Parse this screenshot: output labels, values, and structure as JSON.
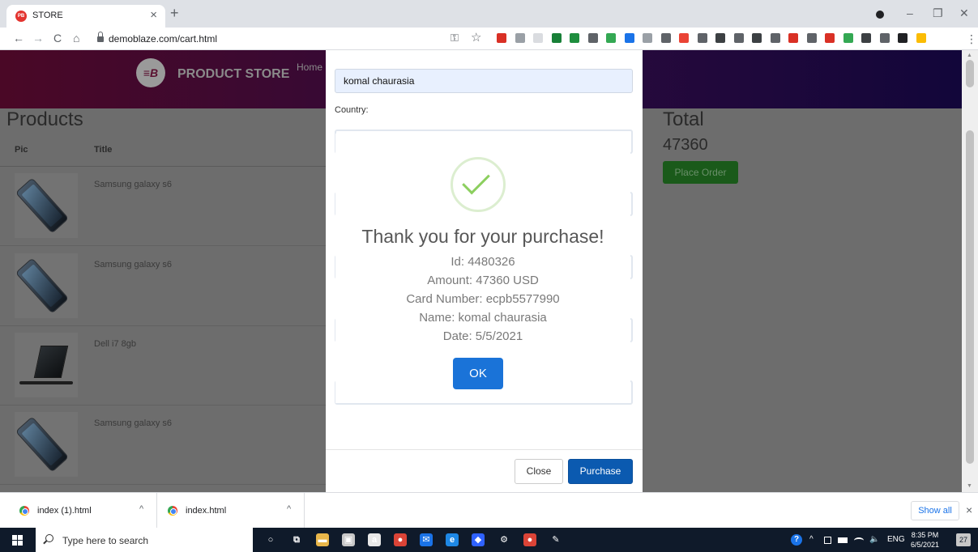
{
  "browser": {
    "tab_title": "STORE",
    "favicon_text": "PB",
    "new_tab_symbol": "+",
    "close_tab_symbol": "×",
    "url": "demoblaze.com/cart.html",
    "window_controls": [
      "–",
      "❐",
      "✕"
    ],
    "nav": {
      "back": "←",
      "forward": "→",
      "reload": "C",
      "home": "⌂"
    },
    "omnibox_icons": {
      "key": "⚿",
      "star": "☆"
    },
    "extension_colors": [
      "#d93025",
      "#9aa0a6",
      "#dadce0",
      "#188038",
      "#1e8e3e",
      "#5f6368",
      "#34a853",
      "#1a73e8",
      "#9aa0a6",
      "#5f6368",
      "#ea4335",
      "#5f6368",
      "#3c4043",
      "#5f6368",
      "#3c4043",
      "#5f6368",
      "#d93025",
      "#5f6368",
      "#d93025",
      "#34a853",
      "#3c4043",
      "#5f6368",
      "#202124",
      "#fbbc04"
    ]
  },
  "store": {
    "brand_letter": "≡B",
    "brand_name": "PRODUCT STORE",
    "nav_home": "Home",
    "products_heading": "Products",
    "columns": {
      "pic": "Pic",
      "title": "Title"
    },
    "rows": [
      {
        "title": "Samsung galaxy s6",
        "image": "phone"
      },
      {
        "title": "Samsung galaxy s6",
        "image": "phone"
      },
      {
        "title": "Dell i7 8gb",
        "image": "laptop"
      },
      {
        "title": "Samsung galaxy s6",
        "image": "phone"
      }
    ],
    "total_heading": "Total",
    "total_value": "47360",
    "place_order_label": "Place Order"
  },
  "modal": {
    "name_value": "komal chaurasia",
    "country_label": "Country:",
    "close_label": "Close",
    "purchase_label": "Purchase"
  },
  "alert": {
    "title": "Thank you for your purchase!",
    "lines": [
      "Id: 4480326",
      "Amount: 47360 USD",
      "Card Number: ecpb5577990",
      "Name: komal chaurasia",
      "Date: 5/5/2021"
    ],
    "ok_label": "OK",
    "success_color": "#8ccf5f"
  },
  "downloads": {
    "items": [
      {
        "name": "index (1).html",
        "caret": "^"
      },
      {
        "name": "index.html",
        "caret": "^"
      }
    ],
    "show_all_label": "Show all",
    "close_symbol": "×"
  },
  "taskbar": {
    "search_placeholder": "Type here to search",
    "language": "ENG",
    "time": "8:35 PM",
    "date": "6/5/2021",
    "notification_count": "27",
    "tray_symbols": {
      "help": "?",
      "chevron": "^",
      "volume": "🔈"
    },
    "apps": [
      {
        "name": "cortana",
        "glyph": "○",
        "color": "transparent"
      },
      {
        "name": "task-view",
        "glyph": "⧉",
        "color": "transparent"
      },
      {
        "name": "file-explorer",
        "glyph": "▬",
        "color": "#e8b64a"
      },
      {
        "name": "store",
        "glyph": "▣",
        "color": "#c8c8c8"
      },
      {
        "name": "amazon",
        "glyph": "a",
        "color": "#e8e8e8"
      },
      {
        "name": "chrome",
        "glyph": "●",
        "color": "#db4437"
      },
      {
        "name": "mail",
        "glyph": "✉",
        "color": "#1a73e8"
      },
      {
        "name": "edge",
        "glyph": "e",
        "color": "#1e88e5"
      },
      {
        "name": "dropbox",
        "glyph": "◆",
        "color": "#2f62ff"
      },
      {
        "name": "settings",
        "glyph": "⚙",
        "color": "transparent"
      },
      {
        "name": "chrome-2",
        "glyph": "●",
        "color": "#db4437"
      },
      {
        "name": "paint",
        "glyph": "✎",
        "color": "transparent"
      }
    ]
  }
}
